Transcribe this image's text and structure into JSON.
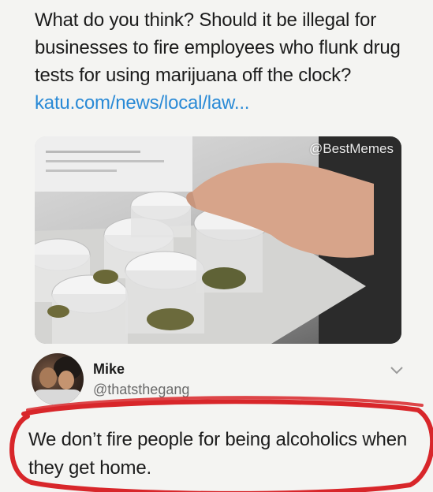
{
  "post": {
    "text": "What do you think? Should it be illegal for businesses to fire employees who flunk drug tests for using marijuana off the clock?",
    "link": "katu.com/news/local/law..."
  },
  "media": {
    "watermark": "@BestMemes"
  },
  "reply": {
    "name": "Mike",
    "handle": "@thatsthegang",
    "text": "We don’t fire people for being alcoholics when they get home."
  },
  "annotation": {
    "circle_color": "#d8262a"
  },
  "colors": {
    "link": "#2a8ad6",
    "text": "#1c1c1c",
    "handle": "#6a6a6a"
  }
}
